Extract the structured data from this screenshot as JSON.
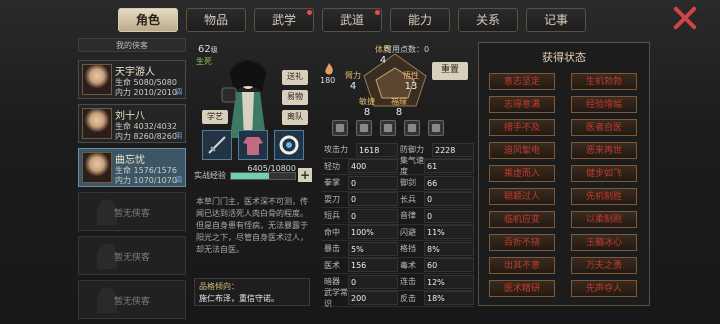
{
  "tabs": [
    {
      "label": "角色",
      "active": true,
      "dot": false
    },
    {
      "label": "物品",
      "active": false,
      "dot": false
    },
    {
      "label": "武学",
      "active": false,
      "dot": true
    },
    {
      "label": "武道",
      "active": false,
      "dot": true
    },
    {
      "label": "能力",
      "active": false,
      "dot": false
    },
    {
      "label": "关系",
      "active": false,
      "dot": false
    },
    {
      "label": "记事",
      "active": false,
      "dot": false
    }
  ],
  "list_title": "我的侠客",
  "characters": [
    {
      "name": "天宇游人",
      "hp": "生命 5080/5080",
      "mp": "内力 2010/2010",
      "tag": "调",
      "selected": false
    },
    {
      "name": "刘十八",
      "hp": "生命 4032/4032",
      "mp": "内力 8260/8260",
      "tag": "阴",
      "selected": false
    },
    {
      "name": "曲忘忧",
      "hp": "生命 1576/1576",
      "mp": "内力 1070/1070",
      "tag": "调",
      "selected": true
    }
  ],
  "empty_slots": [
    "暂无侠客",
    "暂无侠客",
    "暂无侠客"
  ],
  "profile": {
    "level": "62",
    "level_unit": "级",
    "clan": "生死",
    "buttons": [
      "送礼",
      "易物",
      "离队"
    ],
    "skill_label": "学艺",
    "exp_label": "实战经验",
    "exp_value": "6405/10800",
    "exp_fraction": 0.593,
    "description": "本草门门主，医术深不可测，传闻已达到活死人肉白骨的程度。但是自身患有怪病，无法暴露于阳光之下，尽管自身医术过人，却无法自医。",
    "tendency_label": "品格倾向：",
    "tendency_value": "施仁布泽，重信守诺。"
  },
  "attributes": {
    "points_label": "可用点数：",
    "points": "0",
    "reset": "重置",
    "level": "180",
    "items": [
      {
        "name": "体质",
        "value": "4"
      },
      {
        "name": "臂力",
        "value": "4"
      },
      {
        "name": "悟性",
        "value": "13"
      },
      {
        "name": "敏捷",
        "value": "8"
      },
      {
        "name": "福缘",
        "value": "8"
      }
    ]
  },
  "stats": [
    [
      [
        "攻击力",
        "1618",
        "+200"
      ],
      [
        "防御力",
        "2228",
        "+230"
      ]
    ],
    [
      [
        "轻功",
        "400",
        ""
      ],
      [
        "集气速度",
        "61",
        ""
      ]
    ],
    [
      [
        "拳掌",
        "0",
        ""
      ],
      [
        "御剑",
        "66",
        ""
      ]
    ],
    [
      [
        "耍刀",
        "0",
        ""
      ],
      [
        "长兵",
        "0",
        ""
      ]
    ],
    [
      [
        "短兵",
        "0",
        ""
      ],
      [
        "音律",
        "0",
        ""
      ]
    ],
    [
      [
        "命中",
        "100%",
        ""
      ],
      [
        "闪避",
        "11%",
        ""
      ]
    ],
    [
      [
        "暴击",
        "5%",
        ""
      ],
      [
        "格挡",
        "8%",
        ""
      ]
    ],
    [
      [
        "医术",
        "156",
        ""
      ],
      [
        "毒术",
        "60",
        ""
      ]
    ],
    [
      [
        "暗器",
        "0",
        ""
      ],
      [
        "连击",
        "12%",
        ""
      ]
    ],
    [
      [
        "武学常识",
        "200",
        ""
      ],
      [
        "反击",
        "18%",
        ""
      ]
    ]
  ],
  "status_panel": {
    "title": "获得状态",
    "items": [
      {
        "label": "意志坚定",
        "color": "red"
      },
      {
        "label": "生机勃勃",
        "color": "red"
      },
      {
        "label": "志得意满",
        "color": "red"
      },
      {
        "label": "经验增幅",
        "color": "red"
      },
      {
        "label": "措手不及",
        "color": "red"
      },
      {
        "label": "医者自医",
        "color": "red"
      },
      {
        "label": "追风掣电",
        "color": "red"
      },
      {
        "label": "恶来再世",
        "color": "red"
      },
      {
        "label": "乘虚而入",
        "color": "red"
      },
      {
        "label": "健步如飞",
        "color": "red"
      },
      {
        "label": "聪颖过人",
        "color": "red"
      },
      {
        "label": "先机制胜",
        "color": "red"
      },
      {
        "label": "临机应变",
        "color": "red"
      },
      {
        "label": "以柔制刚",
        "color": "red"
      },
      {
        "label": "百折不挠",
        "color": "red"
      },
      {
        "label": "玉髓冰心",
        "color": "red"
      },
      {
        "label": "出其不意",
        "color": "red"
      },
      {
        "label": "万夫之勇",
        "color": "red"
      },
      {
        "label": "医术精研",
        "color": "red"
      },
      {
        "label": "先声夺人",
        "color": "red"
      }
    ]
  }
}
